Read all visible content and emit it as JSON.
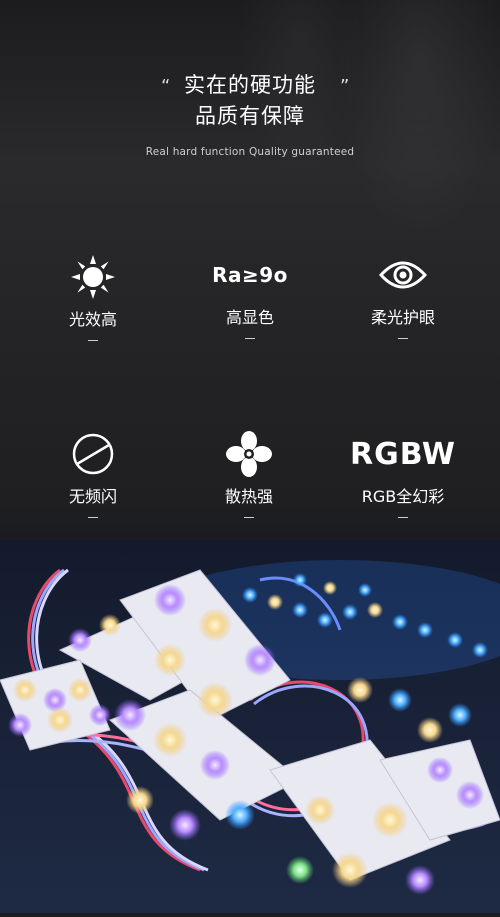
{
  "header": {
    "quote_open": "“",
    "quote_close": "”",
    "title_line1": "实在的硬功能",
    "title_line2": "品质有保障",
    "subtitle": "Real hard function Quality guaranteed"
  },
  "features": [
    {
      "icon": "sun-icon",
      "label": "光效高"
    },
    {
      "icon": "ra-text-icon",
      "icon_text": "Ra≥9o",
      "label": "高显色"
    },
    {
      "icon": "eye-icon",
      "label": "柔光护眼"
    },
    {
      "icon": "no-flicker-icon",
      "label": "无频闪"
    },
    {
      "icon": "fan-icon",
      "label": "散热强"
    },
    {
      "icon": "rgbw-text-icon",
      "icon_text": "RGBW",
      "label": "RGB全幻彩"
    }
  ],
  "colors": {
    "background": "#222224",
    "text": "#ffffff"
  }
}
